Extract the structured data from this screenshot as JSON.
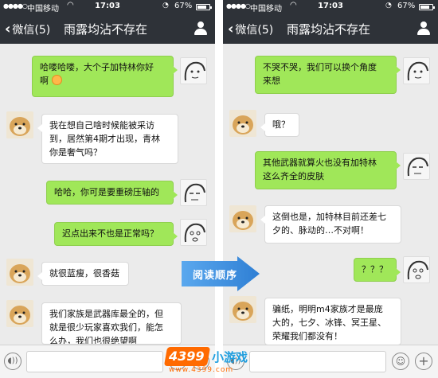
{
  "status_bar": {
    "carrier": "中国移动",
    "time": "17:03",
    "battery": "67%",
    "battery_level": 0.67,
    "signal_icon": "signal-dots-icon",
    "wifi_icon": "wifi-icon"
  },
  "left_phone": {
    "nav": {
      "back_label": "微信(5)",
      "title": "雨露均沾不存在"
    },
    "messages": [
      {
        "side": "right",
        "text_lines": [
          "哈喽哈喽，大个子加特林你好",
          "啊"
        ],
        "emoji": "blush-emoji-icon"
      },
      {
        "side": "left",
        "text_lines": [
          "我在想自己啥时候能被采访",
          "到，居然第4期才出现，青林",
          "你是奢气吗？"
        ]
      },
      {
        "side": "right",
        "text_lines": [
          "哈哈，你可是要重磅压轴的"
        ]
      },
      {
        "side": "right",
        "text_lines": [
          "迟点出来不也是正常吗？"
        ]
      },
      {
        "side": "left",
        "text_lines": [
          "就很蓝瘦，很香菇"
        ]
      },
      {
        "side": "left",
        "text_lines": [
          "我们家族是武器库最全的，但",
          "就是很少玩家喜欢我们，能怎",
          "么办，我们也很绝望啊"
        ]
      }
    ]
  },
  "right_phone": {
    "nav": {
      "back_label": "微信(5)",
      "title": "雨露均沾不存在"
    },
    "messages": [
      {
        "side": "right",
        "text_lines": [
          "不哭不哭，我们可以换个角度",
          "来想"
        ]
      },
      {
        "side": "left",
        "text_lines": [
          "哦？"
        ]
      },
      {
        "side": "right",
        "text_lines": [
          "其他武器就算火也没有加特林",
          "这么齐全的皮肤"
        ]
      },
      {
        "side": "left",
        "text_lines": [
          "这倒也是，加特林目前还差七",
          "夕的、脉动的…不对啊！"
        ]
      },
      {
        "side": "right",
        "text_lines": [
          "？？？"
        ]
      },
      {
        "side": "left",
        "text_lines": [
          "骗纸，明明m4家族才是最庞",
          "大的，七夕、冰锋、冥王星、",
          "荣耀我们都没有！"
        ]
      }
    ]
  },
  "arrow": {
    "label": "阅读顺序",
    "color": "#3e8fe0"
  },
  "watermark": {
    "logo": "4399",
    "brand": "小游戏",
    "url": "www.4399.com"
  },
  "colors": {
    "nav_bg": "#2e3238",
    "chat_bg": "#ebebeb",
    "bubble_green": "#a0e759",
    "bubble_white": "#ffffff"
  }
}
